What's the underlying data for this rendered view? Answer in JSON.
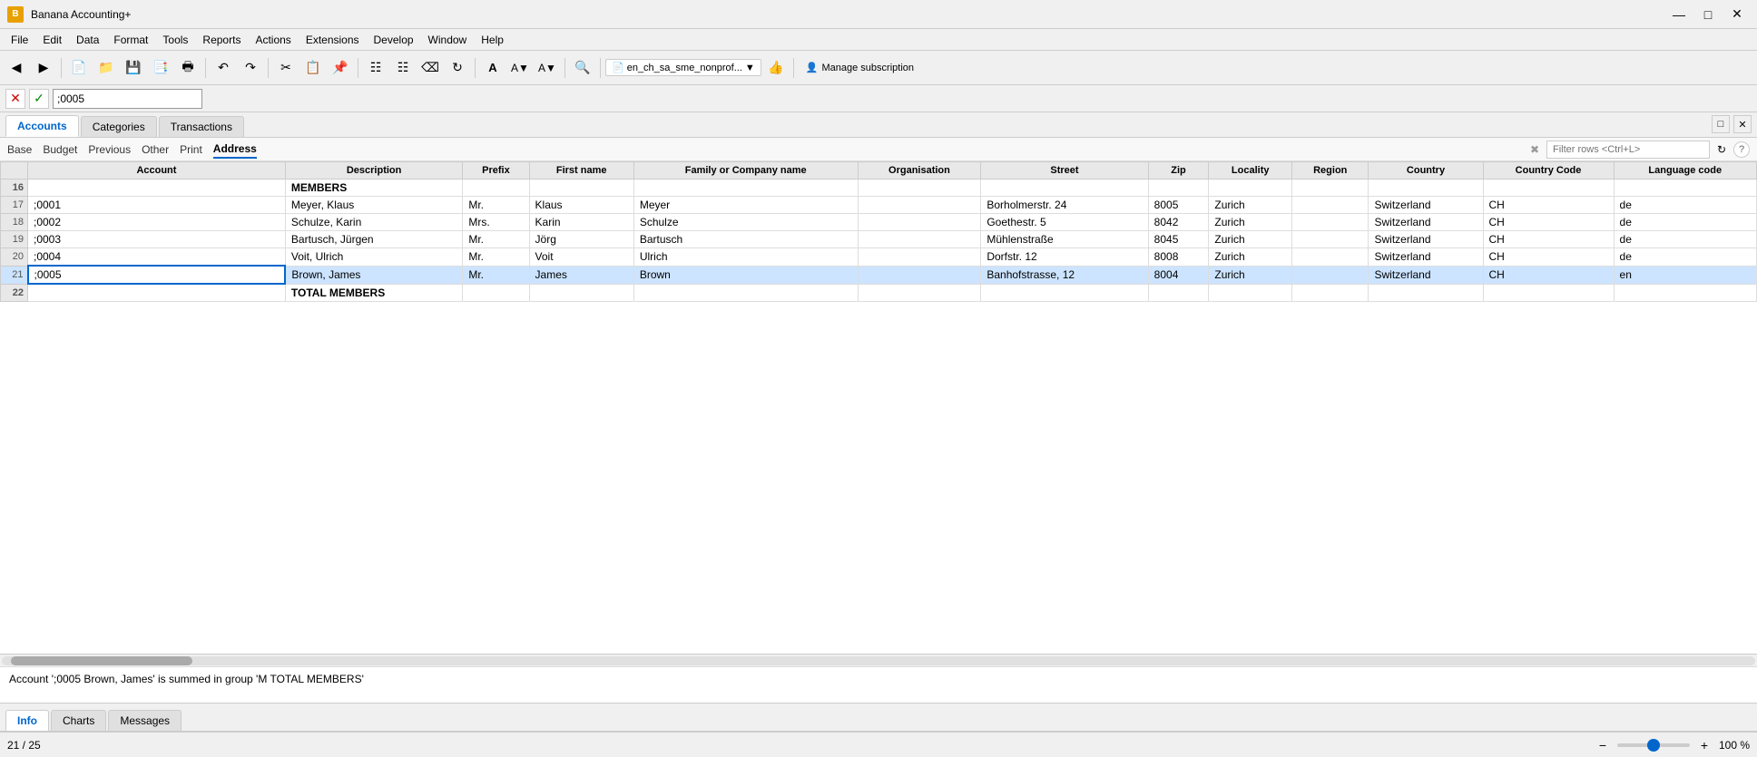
{
  "app": {
    "title": "Banana Accounting+",
    "logo_text": "B"
  },
  "title_controls": {
    "minimize": "—",
    "maximize": "□",
    "close": "✕"
  },
  "menu": {
    "items": [
      "File",
      "Edit",
      "Data",
      "Format",
      "Tools",
      "Reports",
      "Actions",
      "Extensions",
      "Develop",
      "Window",
      "Help"
    ]
  },
  "formula_bar": {
    "cancel_icon": "✕",
    "confirm_icon": "✓",
    "value": ";0005"
  },
  "tabs": {
    "items": [
      "Accounts",
      "Categories",
      "Transactions"
    ],
    "active": "Accounts"
  },
  "sub_nav": {
    "items": [
      "Base",
      "Budget",
      "Previous",
      "Other",
      "Print",
      "Address"
    ],
    "active": "Address",
    "filter_placeholder": "Filter rows <Ctrl+L>"
  },
  "table": {
    "columns": [
      "Account",
      "Description",
      "Prefix",
      "First name",
      "Family or Company name",
      "Organisation",
      "Street",
      "Zip",
      "Locality",
      "Region",
      "Country",
      "Country Code",
      "Language code"
    ],
    "rows": [
      {
        "row_num": "16",
        "account": "",
        "description": "MEMBERS",
        "prefix": "",
        "firstname": "",
        "family": "",
        "org": "",
        "street": "",
        "zip": "",
        "locality": "",
        "region": "",
        "country": "",
        "ccode": "",
        "lang": "",
        "is_group": true
      },
      {
        "row_num": "17",
        "account": ";0001",
        "description": "Meyer, Klaus",
        "prefix": "Mr.",
        "firstname": "Klaus",
        "family": "Meyer",
        "org": "",
        "street": "Borholmerstr. 24",
        "zip": "8005",
        "locality": "Zurich",
        "region": "",
        "country": "Switzerland",
        "ccode": "CH",
        "lang": "de",
        "is_group": false
      },
      {
        "row_num": "18",
        "account": ";0002",
        "description": "Schulze, Karin",
        "prefix": "Mrs.",
        "firstname": "Karin",
        "family": "Schulze",
        "org": "",
        "street": "Goethestr. 5",
        "zip": "8042",
        "locality": "Zurich",
        "region": "",
        "country": "Switzerland",
        "ccode": "CH",
        "lang": "de",
        "is_group": false
      },
      {
        "row_num": "19",
        "account": ";0003",
        "description": "Bartusch, Jürgen",
        "prefix": "Mr.",
        "firstname": "Jörg",
        "family": "Bartusch",
        "org": "",
        "street": "Mühlenstraße",
        "zip": "8045",
        "locality": "Zurich",
        "region": "",
        "country": "Switzerland",
        "ccode": "CH",
        "lang": "de",
        "is_group": false
      },
      {
        "row_num": "20",
        "account": ";0004",
        "description": "Voit, Ulrich",
        "prefix": "Mr.",
        "firstname": "Voit",
        "family": "Ulrich",
        "org": "",
        "street": "Dorfstr. 12",
        "zip": "8008",
        "locality": "Zurich",
        "region": "",
        "country": "Switzerland",
        "ccode": "CH",
        "lang": "de",
        "is_group": false
      },
      {
        "row_num": "21",
        "account": ";0005",
        "description": "Brown, James",
        "prefix": "Mr.",
        "firstname": "James",
        "family": "Brown",
        "org": "",
        "street": "Banhofstrasse, 12",
        "zip": "8004",
        "locality": "Zurich",
        "region": "",
        "country": "Switzerland",
        "ccode": "CH",
        "lang": "en",
        "is_group": false,
        "selected": true
      },
      {
        "row_num": "22",
        "account": "",
        "description": "TOTAL MEMBERS",
        "prefix": "",
        "firstname": "",
        "family": "",
        "org": "",
        "street": "",
        "zip": "",
        "locality": "",
        "region": "",
        "country": "",
        "ccode": "",
        "lang": "",
        "is_group": true
      }
    ]
  },
  "status_info": {
    "message": "Account ';0005 Brown, James' is summed in group 'M TOTAL MEMBERS'"
  },
  "bottom_tabs": {
    "items": [
      "Info",
      "Charts",
      "Messages"
    ],
    "active": "Info"
  },
  "bottom_status": {
    "position": "21 / 25",
    "zoom": "100 %"
  },
  "file_btn": {
    "label": "en_ch_sa_sme_nonprof...",
    "icon": "📄"
  },
  "manage_btn": {
    "label": "Manage subscription",
    "icon": "👤"
  }
}
